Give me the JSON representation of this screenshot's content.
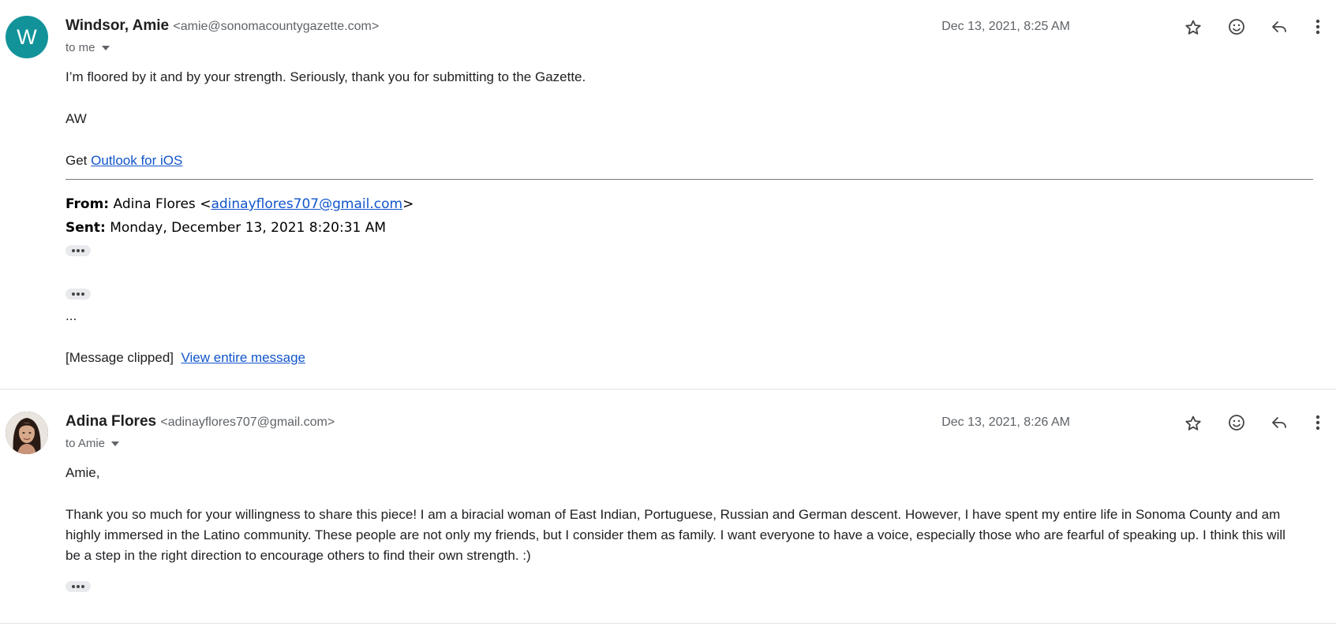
{
  "message1": {
    "avatar_letter": "W",
    "sender_name": "Windsor, Amie",
    "sender_email": "<amie@sonomacountygazette.com>",
    "recipient": "to me",
    "date": "Dec 13, 2021, 8:25 AM",
    "body_line1": "I’m floored by it and by your strength. Seriously, thank you for submitting to the Gazette.",
    "signature": "AW",
    "get_prefix": "Get",
    "get_link": "Outlook for iOS",
    "quoted": {
      "from_label": "From:",
      "from_name": "Adina Flores <",
      "from_email": "adinayflores707@gmail.com",
      "from_suffix": ">",
      "sent_label": "Sent:",
      "sent_value": "Monday, December 13, 2021 8:20:31 AM"
    },
    "ellipsis": "...",
    "clipped_text": "[Message clipped]",
    "view_entire_link": "View entire message"
  },
  "message2": {
    "sender_name": "Adina Flores",
    "sender_email": "<adinayflores707@gmail.com>",
    "recipient": "to Amie",
    "date": "Dec 13, 2021, 8:26 AM",
    "greeting": "Amie,",
    "body_line1": "Thank you so much for your willingness to share this piece! I am a biracial woman of East Indian, Portuguese, Russian and German descent. However, I have spent my entire life in Sonoma County and am",
    "body_line2": "highly immersed in the Latino community. These people are not only my friends, but I consider them as family. I want everyone to have a voice, especially those who are fearful of speaking up. I think this will",
    "body_line3": "be a step in the right direction to encourage others to find their own strength. :)"
  },
  "icons": {
    "star": "star-icon",
    "emoji": "emoji-icon",
    "reply": "reply-icon",
    "more": "more-vert-icon"
  },
  "colors": {
    "avatar_bg": "#12939a",
    "link": "#1155cc",
    "meta_text": "#5f6368"
  }
}
